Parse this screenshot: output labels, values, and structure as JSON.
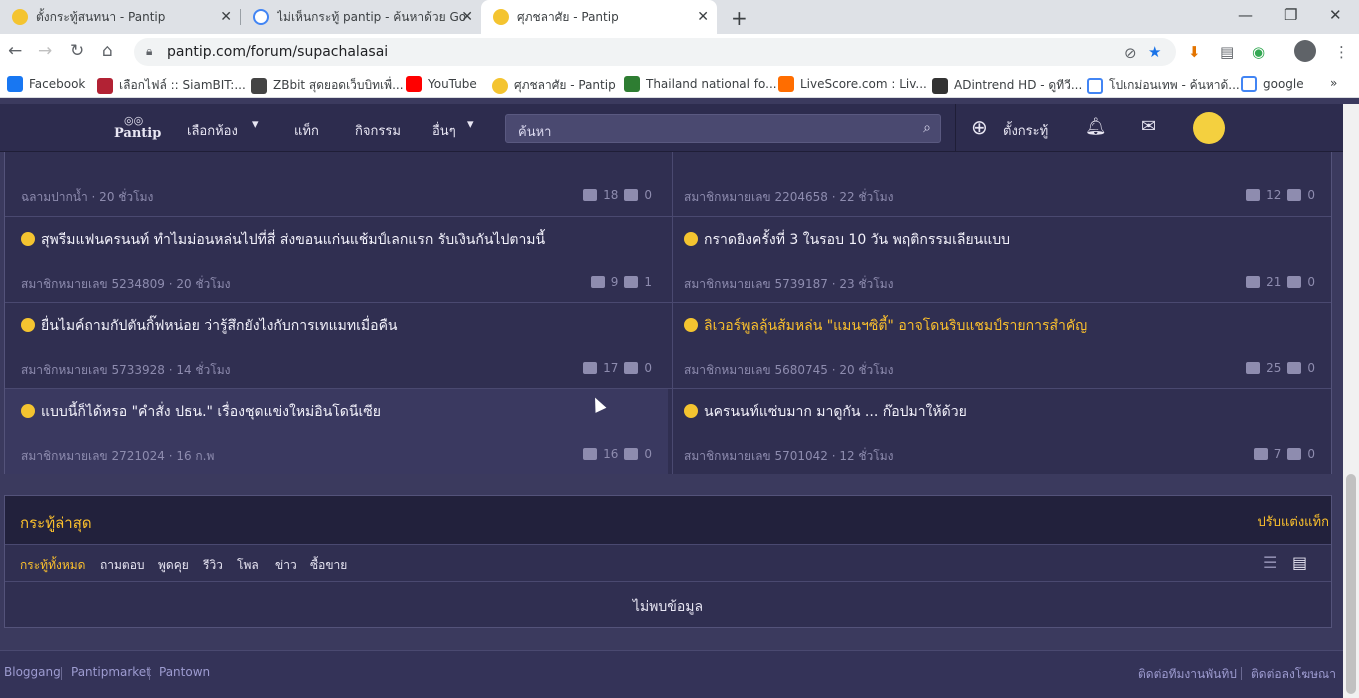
{
  "browser": {
    "tabs": [
      {
        "title": "ตั้งกระทู้สนทนา - Pantip",
        "active": false
      },
      {
        "title": "ไม่เห็นกระทู้ pantip - ค้นหาด้วย Goo",
        "active": false
      },
      {
        "title": "ศุภชลาศัย - Pantip",
        "active": true
      }
    ],
    "url": "pantip.com/forum/supachalasai",
    "bookmarks": [
      "Facebook",
      "เลือกไฟล์ :: SiamBIT:...",
      "ZBbit สุดยอดเว็บบิทเพื่...",
      "YouTube",
      "ศุภชลาศัย - Pantip",
      "Thailand national fo...",
      "LiveScore.com : Liv...",
      "ADintrend HD - ดูทีวี...",
      "โปเกม่อนเทพ - ค้นหาด้...",
      "google"
    ]
  },
  "pantip_nav": {
    "logo": "Pantip",
    "menu": [
      "เลือกห้อง",
      "แท็ก",
      "กิจกรรม",
      "อื่นๆ"
    ],
    "search_placeholder": "ค้นหา",
    "new_topic": "ตั้งกระทู้"
  },
  "topics_partial": [
    {
      "meta": "ฉลามปากน้ำ · 20 ชั่วโมง",
      "comments": "18",
      "votes": "0"
    },
    {
      "meta": "สมาชิกหมายเลข 2204658 · 22 ชั่วโมง",
      "comments": "12",
      "votes": "0"
    }
  ],
  "topics": [
    {
      "title": "สุพรีมแฟนครนนท์ ทำไมม่อนหล่นไปที่สี่ ส่งขอนแก่นแช้มป์เลกแรก รับเงินกันไปตามนี้",
      "meta": "สมาชิกหมายเลข 5234809 · 20 ชั่วโมง",
      "comments": "9",
      "votes": "1"
    },
    {
      "title": "กราดยิงครั้งที่ 3 ในรอบ 10 วัน พฤติกรรมเลียนแบบ",
      "meta": "สมาชิกหมายเลข 5739187 · 23 ชั่วโมง",
      "comments": "21",
      "votes": "0"
    },
    {
      "title": "ยื่นไมค์ถามกัปตันกิ๊ฟหน่อย ว่ารู้สึกยังไงกับการเทแมทเมื่อคืน",
      "meta": "สมาชิกหมายเลข 5733928 · 14 ชั่วโมง",
      "comments": "17",
      "votes": "0"
    },
    {
      "title": "ลิเวอร์พูลลุ้นส้มหล่น \"แมนฯซิตี้\" อาจโดนริบแชมป์รายการสำคัญ",
      "meta": "สมาชิกหมายเลข 5680745 · 20 ชั่วโมง",
      "comments": "25",
      "votes": "0"
    },
    {
      "title": "แบบนี้ก็ได้หรอ \"คำสั่ง ปธน.\" เรื่องชุดแข่งใหม่อินโดนีเซีย",
      "meta": "สมาชิกหมายเลข 2721024 · 16 ก.พ",
      "comments": "16",
      "votes": "0"
    },
    {
      "title": "นครนนท์แซ่บมาก มาดูกัน ... ก๊อปมาให้ด้วย",
      "meta": "สมาชิกหมายเลข 5701042 · 12 ชั่วโมง",
      "comments": "7",
      "votes": "0"
    }
  ],
  "latest": {
    "title": "กระทู้ล่าสุด",
    "customize": "ปรับแต่งแท็ก",
    "filters": [
      "กระทู้ทั้งหมด",
      "ถามตอบ",
      "พูดคุย",
      "รีวิว",
      "โพล",
      "ข่าว",
      "ซื้อขาย"
    ],
    "empty": "ไม่พบข้อมูล"
  },
  "footer": {
    "left": [
      "Bloggang",
      "Pantipmarket",
      "Pantown"
    ],
    "right": [
      "ติดต่อทีมงานพันทิป",
      "ติดต่อลงโฆษณา"
    ]
  },
  "colors": {
    "accent": "#fbc02d",
    "nav_bg": "#2d2c4e",
    "page_bg": "#3b3a5e"
  }
}
